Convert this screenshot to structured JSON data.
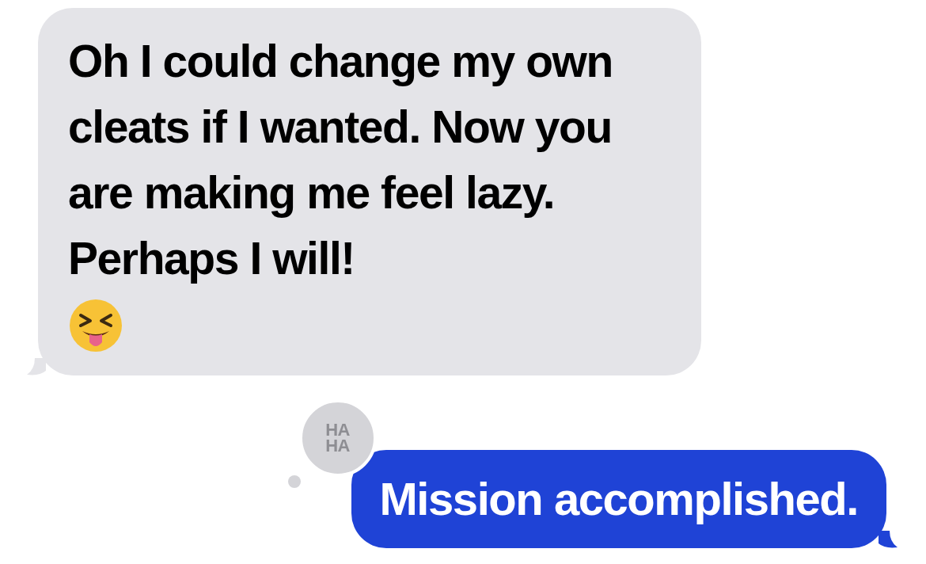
{
  "messages": [
    {
      "kind": "incoming",
      "text": "Oh I could change my own cleats if I wanted. Now you are making me feel lazy. Perhaps I will!",
      "trailing_emoji": true
    },
    {
      "kind": "outgoing",
      "text": "Mission accomplished.",
      "reaction": {
        "kind": "haha",
        "lines": [
          "HA",
          "HA"
        ]
      }
    }
  ]
}
